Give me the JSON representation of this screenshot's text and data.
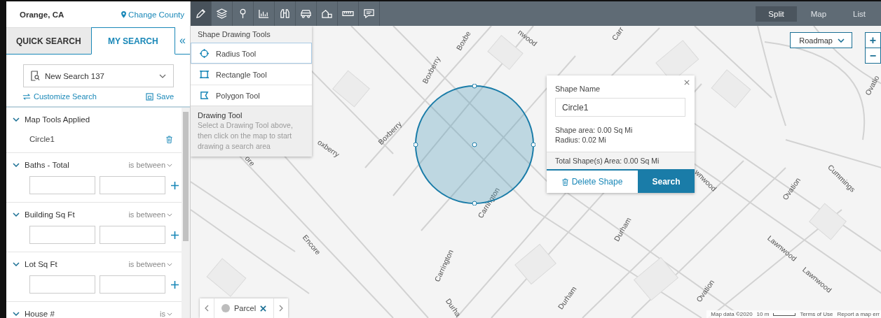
{
  "location": "Orange, CA",
  "change_county": "Change County",
  "tabs": [
    {
      "label": "QUICK SEARCH",
      "selected": false
    },
    {
      "label": "MY SEARCH",
      "selected": true
    }
  ],
  "collapse": "«",
  "search_select": {
    "value": "New Search 137"
  },
  "customize": "Customize Search",
  "save": "Save",
  "filters": [
    {
      "kind": "tools",
      "label": "Map Tools Applied",
      "expanded": true,
      "items": [
        "Circle1"
      ]
    },
    {
      "kind": "range",
      "label": "Baths - Total",
      "operator": "is between",
      "expanded": true
    },
    {
      "kind": "range",
      "label": "Building Sq Ft",
      "operator": "is between",
      "expanded": true
    },
    {
      "kind": "range",
      "label": "Lot Sq Ft",
      "operator": "is between",
      "expanded": true
    },
    {
      "kind": "range",
      "label": "House #",
      "operator": "is",
      "expanded": true
    }
  ],
  "toolbar": [
    {
      "kind": "pencil",
      "selected": true
    },
    {
      "kind": "layers",
      "selected": false
    },
    {
      "kind": "pin",
      "selected": false
    },
    {
      "kind": "chart",
      "selected": false
    },
    {
      "kind": "binoculars",
      "selected": false
    },
    {
      "kind": "car",
      "selected": false
    },
    {
      "kind": "shapes",
      "selected": false
    },
    {
      "kind": "ruler",
      "selected": false
    },
    {
      "kind": "comment",
      "selected": false
    }
  ],
  "view_tabs": [
    {
      "label": "Split",
      "selected": true
    },
    {
      "label": "Map",
      "selected": false
    },
    {
      "label": "List",
      "selected": false
    }
  ],
  "drawing_menu": {
    "title": "Shape Drawing Tools",
    "tools": [
      {
        "kind": "radius",
        "label": "Radius Tool",
        "selected": true
      },
      {
        "kind": "rectangle",
        "label": "Rectangle Tool",
        "selected": false
      },
      {
        "kind": "polygon",
        "label": "Polygon Tool",
        "selected": false
      }
    ],
    "hint_title": "Drawing Tool",
    "hint": "Select a Drawing Tool above, then click on the map to start drawing a search area"
  },
  "map": {
    "type_select": "Roadmap",
    "zoom_in": "+",
    "zoom_out": "−",
    "street_labels": [
      "Boxbe",
      "nwood",
      "Carr",
      "Boxberry",
      "Boxberry",
      "oxberry",
      "ore",
      "Carrington",
      "Encore",
      "Carrington",
      "Durham",
      "Ovation",
      "Cummings",
      "wnwood",
      "Lawnwood",
      "Lawnwood",
      "Durham",
      "Ovation",
      "Durha",
      "Ovatio"
    ],
    "footer": [
      "Map data ©2020",
      "10 m",
      "Terms of Use",
      "Report a map err"
    ]
  },
  "shape_popup": {
    "name_label": "Shape Name",
    "name_value": "Circle1",
    "area": "Shape area: 0.00 Sq Mi",
    "radius": "Radius: 0.02 Mi",
    "total": "Total Shape(s) Area: 0.00 Sq Mi",
    "delete": "Delete Shape",
    "search": "Search"
  },
  "layer_bar": {
    "label": "Parcel"
  }
}
